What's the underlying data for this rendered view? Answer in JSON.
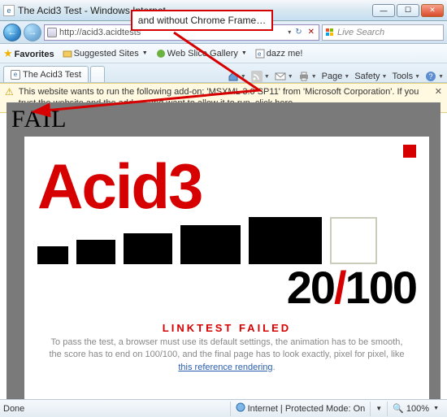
{
  "window": {
    "title": "The Acid3 Test - Windows Internet",
    "min_icon": "—",
    "max_icon": "☐",
    "close_icon": "✕"
  },
  "nav": {
    "back": "←",
    "fwd": "→",
    "url": "http://acid3.acidtests",
    "dropdown": "▾",
    "refresh": "↻",
    "stop": "✕",
    "search_placeholder": "Live Search"
  },
  "favbar": {
    "label": "Favorites",
    "items": [
      "Suggested Sites",
      "Web Slice Gallery",
      "dazz me!"
    ]
  },
  "tab": {
    "title": "The Acid3 Test"
  },
  "toolbar": {
    "page": "Page",
    "safety": "Safety",
    "tools": "Tools"
  },
  "infobar": {
    "text": "This website wants to run the following add-on: 'MSXML 3.0 SP11' from 'Microsoft Corporation'. If you trust the website and the add-on and want to allow it to run, click here...",
    "close": "✕"
  },
  "page": {
    "fail": "FAIL",
    "heading": "Acid3",
    "score_num": "20",
    "score_sep": "/",
    "score_den": "100",
    "linktest": "LINKTEST FAILED",
    "blurb_pre": "To pass the test, a browser must use its default settings, the animation has to be smooth, the score has to end on 100/100, and the final page has to look exactly, pixel for pixel, like ",
    "blurb_link": "this reference rendering",
    "blurb_post": "."
  },
  "status": {
    "done": "Done",
    "zone": "Internet | Protected Mode: On",
    "zoom": "100%"
  },
  "annotation": {
    "text": "and without Chrome Frame…"
  }
}
